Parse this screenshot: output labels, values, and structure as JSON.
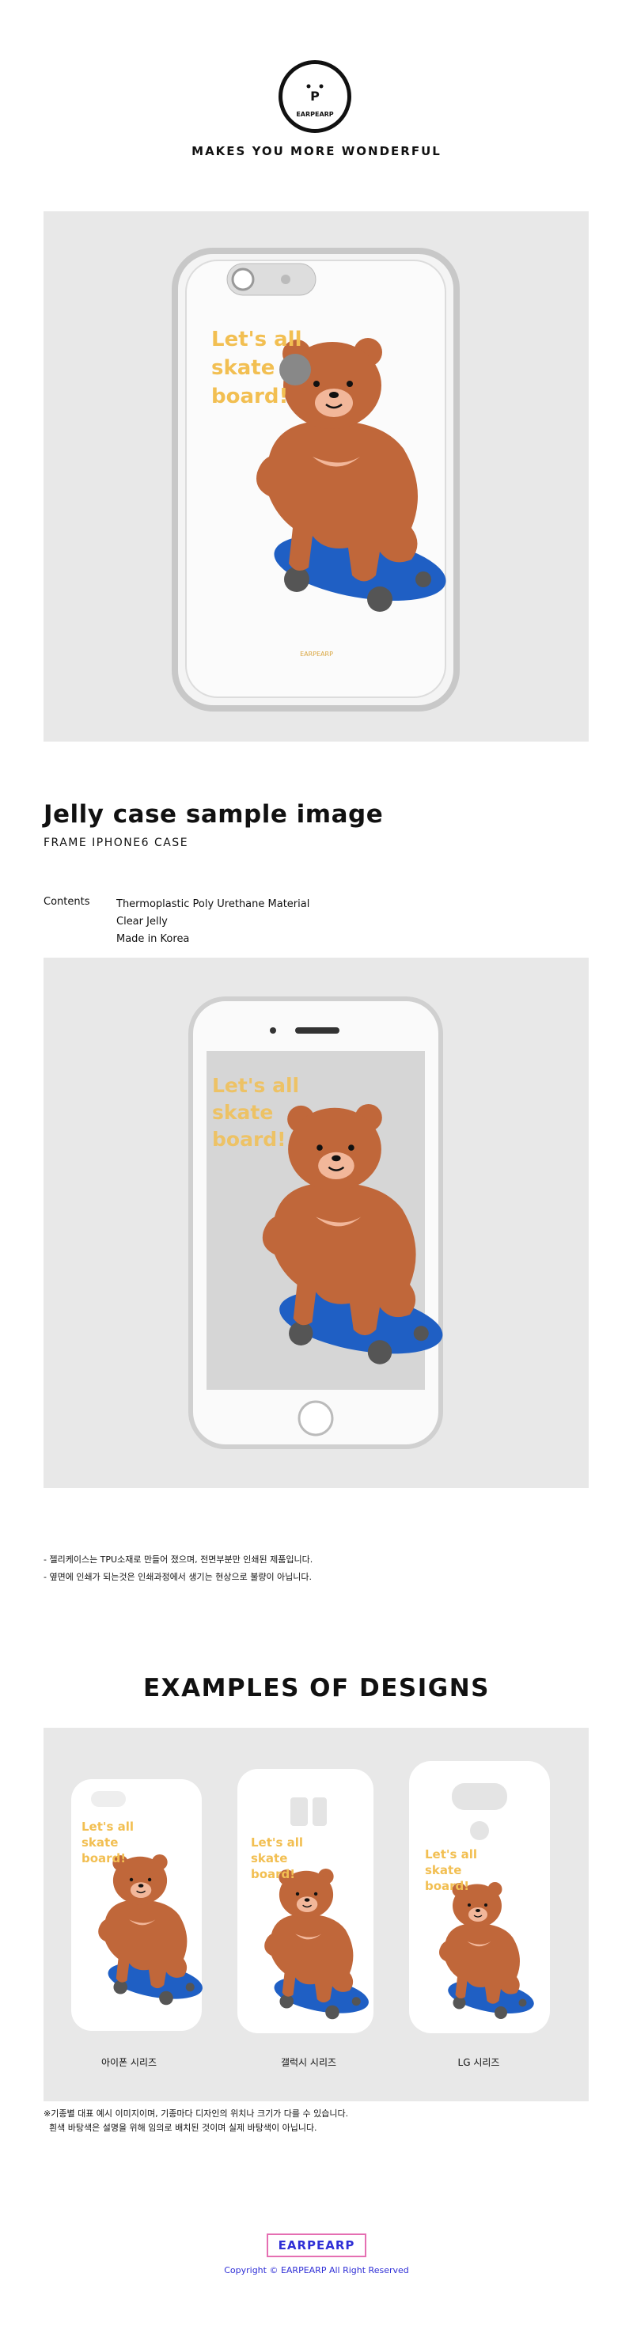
{
  "header": {
    "logo_letter": "P",
    "logo_ring_text": "EARPEARP",
    "tagline": "MAKES YOU MORE WONDERFUL"
  },
  "artwork": {
    "slogan_lines": [
      "Let's all",
      "skate",
      "board!"
    ],
    "case_tag": "EARPEARP"
  },
  "product": {
    "title": "Jelly case sample image",
    "subtitle": "FRAME IPHONE6 CASE",
    "contents_label": "Contents",
    "contents_lines": [
      "Thermoplastic Poly Urethane Material",
      "Clear Jelly",
      "Made in Korea"
    ]
  },
  "notes": [
    "- 젤리케이스는 TPU소재로 만들어 졌으며, 전면부분만 인쇄된 제품입니다.",
    "- 옆면에 인쇄가 되는것은 인쇄과정에서 생기는 현상으로 불량이 아닙니다."
  ],
  "examples": {
    "title": "EXAMPLES OF DESIGNS",
    "variants": [
      "아이폰 시리즈",
      "갤럭시 시리즈",
      "LG 시리즈"
    ]
  },
  "footnote": [
    "※기종별 대표 예시 이미지이며, 기종마다 디자인의 위치나 크기가 다를 수 있습니다.",
    "  흰색 바탕색은 설명을 위해 임의로 배치된 것이며 실제 바탕색이 아닙니다."
  ],
  "footer": {
    "brand": "EARPEARP",
    "copyright": "Copyright © EARPEARP All Right Reserved"
  },
  "colors": {
    "bear": "#c0673a",
    "bear_muzzle": "#f2b79a",
    "skateboard": "#1f5fc4",
    "slogan": "#f2bf52",
    "brand_blue": "#2f2fd6",
    "brand_pink": "#e56fb2"
  }
}
